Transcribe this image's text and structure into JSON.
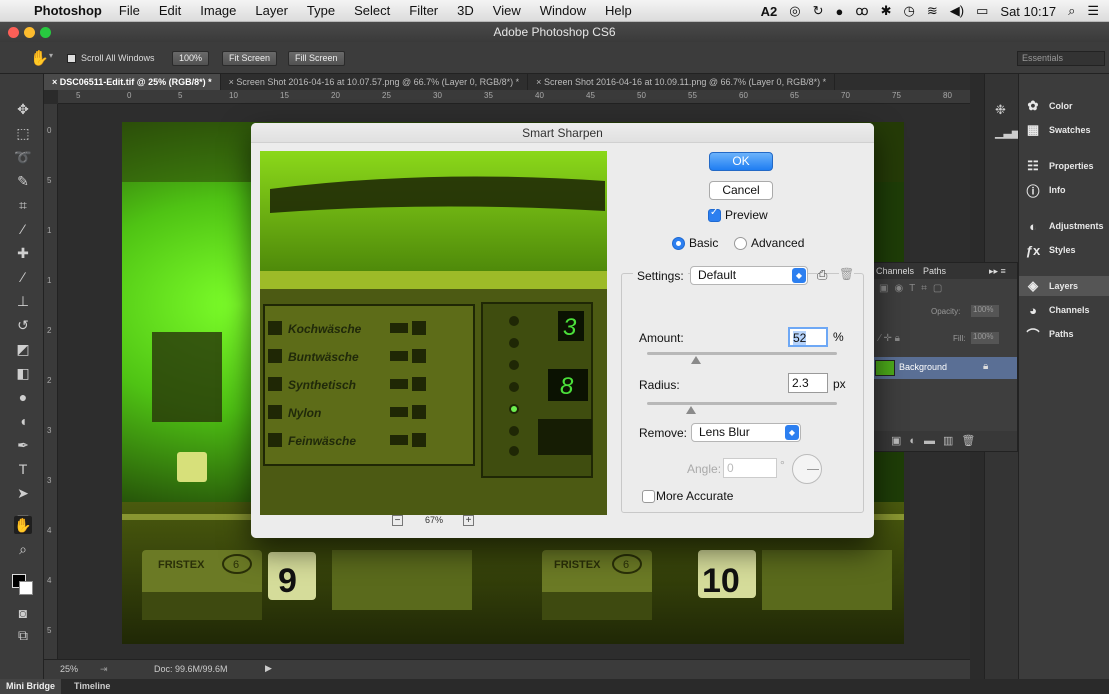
{
  "menubar": {
    "app_name": "Photoshop",
    "items": [
      "File",
      "Edit",
      "Image",
      "Layer",
      "Type",
      "Select",
      "Filter",
      "3D",
      "View",
      "Window",
      "Help"
    ],
    "status_left": "2",
    "clock": "Sat 10:17"
  },
  "window": {
    "title": "Adobe Photoshop CS6"
  },
  "options": {
    "scroll_all_windows": "Scroll All Windows",
    "zoom_100": "100%",
    "fit_screen": "Fit Screen",
    "fill_screen": "Fill Screen",
    "workspace": "Essentials"
  },
  "tabs": [
    {
      "label": "DSC06511-Edit.tif @ 25% (RGB/8*) *",
      "active": true
    },
    {
      "label": "Screen Shot 2016-04-16 at 10.07.57.png @ 66.7% (Layer 0, RGB/8*) *",
      "active": false
    },
    {
      "label": "Screen Shot 2016-04-16 at 10.09.11.png @ 66.7% (Layer 0, RGB/8*) *",
      "active": false
    }
  ],
  "ruler_h": [
    "5",
    "0",
    "5",
    "10",
    "15",
    "20",
    "25",
    "30",
    "35",
    "40",
    "45",
    "50",
    "55",
    "60",
    "65",
    "70",
    "75",
    "80"
  ],
  "ruler_v": [
    "0",
    "5",
    "1",
    "1",
    "2",
    "2",
    "3",
    "3",
    "4",
    "4",
    "5"
  ],
  "statusbar": {
    "zoom": "25%",
    "doc": "Doc: 99.6M/99.6M"
  },
  "bottom_tabs": [
    "Mini Bridge",
    "Timeline"
  ],
  "panels": [
    {
      "label": "Color",
      "icon": "color-wheel-icon"
    },
    {
      "label": "Swatches",
      "icon": "swatches-grid-icon"
    },
    {
      "label": "Properties",
      "icon": "properties-icon"
    },
    {
      "label": "Info",
      "icon": "info-icon"
    },
    {
      "label": "Adjustments",
      "icon": "adjustments-icon"
    },
    {
      "label": "Styles",
      "icon": "styles-icon"
    },
    {
      "label": "Layers",
      "icon": "layers-icon"
    },
    {
      "label": "Channels",
      "icon": "channels-icon"
    },
    {
      "label": "Paths",
      "icon": "paths-icon"
    }
  ],
  "layers_panel": {
    "tabs": [
      "Channels",
      "Paths"
    ],
    "opacity_label": "Opacity:",
    "opacity_value": "100%",
    "fill_label": "Fill:",
    "fill_value": "100%",
    "layer_name": "Background"
  },
  "dialog": {
    "title": "Smart Sharpen",
    "ok": "OK",
    "cancel": "Cancel",
    "preview_label": "Preview",
    "preview_checked": true,
    "mode_basic": "Basic",
    "mode_advanced": "Advanced",
    "mode_selected": "Basic",
    "settings_label": "Settings:",
    "settings_value": "Default",
    "amount_label": "Amount:",
    "amount_value": "52",
    "amount_unit": "%",
    "amount_fraction": 0.26,
    "radius_label": "Radius:",
    "radius_value": "2.3",
    "radius_unit": "px",
    "radius_fraction": 0.23,
    "remove_label": "Remove:",
    "remove_value": "Lens Blur",
    "angle_label": "Angle:",
    "angle_value": "0",
    "angle_unit": "°",
    "more_accurate_label": "More Accurate",
    "zoom_value": "67%",
    "preview_rows": [
      "Kochwäsche",
      "Buntwäsche",
      "Synthetisch",
      "Nylon",
      "Feinwäsche"
    ],
    "preview_digits": [
      "3",
      "8"
    ]
  },
  "photo": {
    "brand": "FRISTEX",
    "numbers": [
      "6",
      "9",
      "6",
      "10"
    ]
  },
  "colors": {
    "accent": "#2c7ff0",
    "photo_green": "#66d41a"
  }
}
